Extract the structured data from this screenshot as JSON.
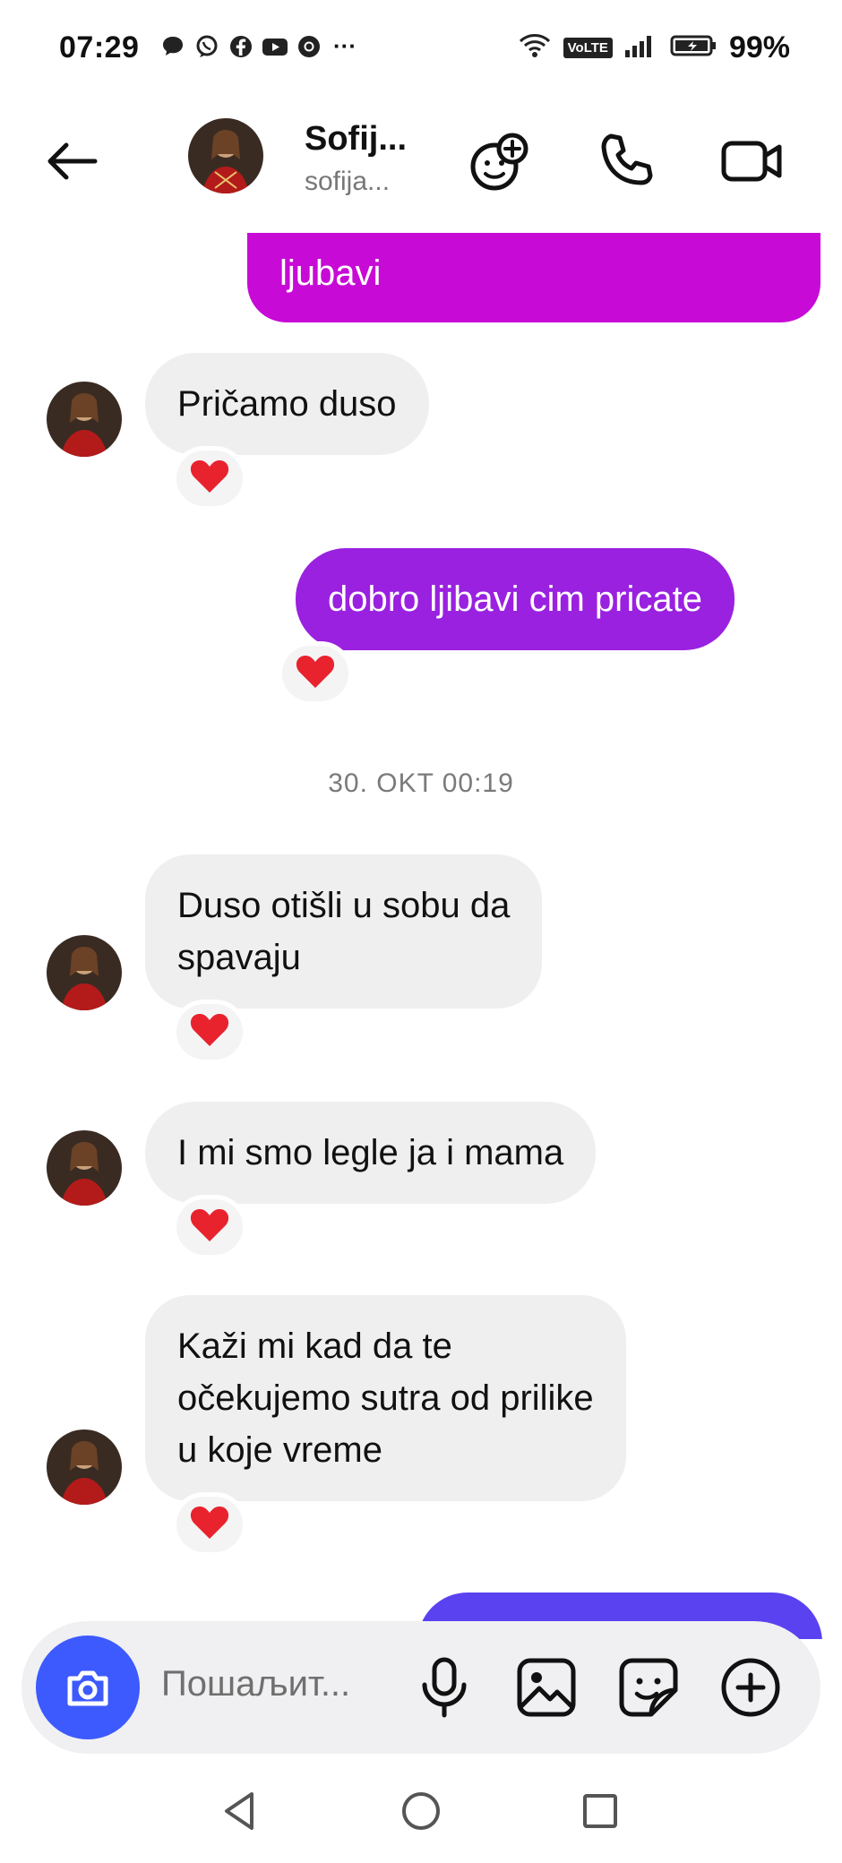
{
  "status_bar": {
    "time": "07:29",
    "left_icons": [
      "chat-bubble-icon",
      "viber-icon",
      "facebook-icon",
      "youtube-icon",
      "chrome-icon"
    ],
    "more": "···",
    "network_badge": "VoLTE",
    "battery": "99%"
  },
  "header": {
    "name": "Sofij...",
    "username": "sofija..."
  },
  "messages": [
    {
      "dir": "out",
      "text": "ljubavi"
    },
    {
      "dir": "in",
      "text": "Pričamo duso",
      "reaction": "❤️"
    },
    {
      "dir": "out",
      "text": "dobro ljibavi cim pricate",
      "reaction": "❤️"
    },
    {
      "timestamp": "30. OKT 00:19"
    },
    {
      "dir": "in",
      "lines": [
        "Duso otišli u sobu da",
        "spavaju"
      ],
      "reaction": "❤️"
    },
    {
      "dir": "in",
      "text": "I mi smo legle ja i mama",
      "reaction": "❤️"
    },
    {
      "dir": "in",
      "lines": [
        "Kaži mi kad da te",
        "očekujemo sutra od prilike",
        "u koje vreme"
      ],
      "reaction": "❤️"
    }
  ],
  "composer": {
    "placeholder": "Пошаљит..."
  },
  "colors": {
    "outgoing_magenta": "#c70ad6",
    "outgoing_purple": "#9a21e0",
    "outgoing_blue": "#5a42f0",
    "incoming": "#efefef",
    "camera_button": "#3d5afe"
  }
}
